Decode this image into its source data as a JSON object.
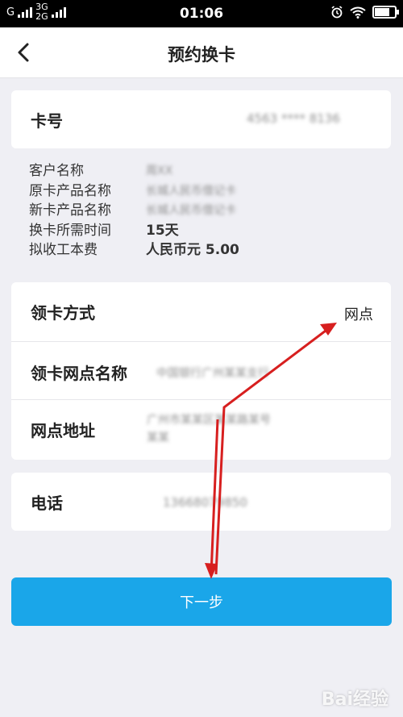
{
  "status": {
    "carrier_primary": "G",
    "carrier_net_top": "3G",
    "carrier_net_bottom": "2G",
    "time": "01:06"
  },
  "header": {
    "title": "预约换卡"
  },
  "card_number": {
    "label": "卡号",
    "value": "4563 **** 8136"
  },
  "info": [
    {
      "key": "客户名称",
      "value": "周XX",
      "blurred": true
    },
    {
      "key": "原卡产品名称",
      "value": "长城人民币借记卡",
      "blurred": true
    },
    {
      "key": "新卡产品名称",
      "value": "长城人民币借记卡",
      "blurred": true
    },
    {
      "key": "换卡所需时间",
      "value": "15天",
      "blurred": false
    },
    {
      "key": "拟收工本费",
      "value": "人民币元 5.00",
      "blurred": false
    }
  ],
  "pickup": {
    "method_label": "领卡方式",
    "method_value": "网点",
    "branch_label": "领卡网点名称",
    "branch_value": "中国银行广州某某支行",
    "address_label": "网点地址",
    "address_value": "广州市某某区某某路某号",
    "address_value_2": "某某"
  },
  "phone": {
    "label": "电话",
    "value": "13668079850"
  },
  "next_button": {
    "label": "下一步"
  },
  "watermark": "Bai经验",
  "colors": {
    "accent": "#1aa6e9",
    "annotation": "#d71f1f"
  }
}
